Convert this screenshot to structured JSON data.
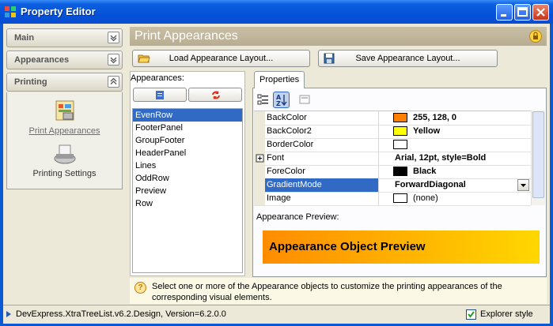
{
  "window": {
    "title": "Property Editor"
  },
  "nav": {
    "groups": [
      {
        "label": "Main",
        "expanded": false
      },
      {
        "label": "Appearances",
        "expanded": false
      },
      {
        "label": "Printing",
        "expanded": true
      }
    ],
    "printing_items": [
      {
        "label": "Print Appearances",
        "selected": true
      },
      {
        "label": "Printing Settings",
        "selected": false
      }
    ]
  },
  "header": {
    "title": "Print Appearances"
  },
  "toolbar": {
    "load_label": "Load Appearance Layout...",
    "save_label": "Save Appearance Layout..."
  },
  "appearances": {
    "label": "Appearances:",
    "items": [
      "EvenRow",
      "FooterPanel",
      "GroupFooter",
      "HeaderPanel",
      "Lines",
      "OddRow",
      "Preview",
      "Row"
    ],
    "selected": "EvenRow"
  },
  "properties": {
    "tab_label": "Properties",
    "rows": [
      {
        "name": "BackColor",
        "value": "255, 128, 0",
        "swatch": "#ff8000"
      },
      {
        "name": "BackColor2",
        "value": "Yellow",
        "swatch": "#ffff00"
      },
      {
        "name": "BorderColor",
        "value": "",
        "swatch": "#ffffff"
      },
      {
        "name": "Font",
        "value": "Arial, 12pt, style=Bold",
        "expandable": true
      },
      {
        "name": "ForeColor",
        "value": "Black",
        "swatch": "#000000"
      },
      {
        "name": "GradientMode",
        "value": "ForwardDiagonal",
        "selected": true
      },
      {
        "name": "Image",
        "value": "(none)",
        "swatch": "#ffffff"
      }
    ]
  },
  "preview": {
    "label": "Appearance Preview:",
    "text": "Appearance Object Preview"
  },
  "hint": {
    "text": "Select one or more of the Appearance objects to customize the printing appearances of the corresponding visual elements."
  },
  "status": {
    "text": "DevExpress.XtraTreeList.v6.2.Design, Version=6.2.0.0",
    "explorer_style_label": "Explorer style",
    "explorer_style_checked": true
  },
  "colors": {
    "title_bar": "#0450d8",
    "selection": "#316ac5",
    "panel": "#ece9d8",
    "header": "#b8ad92"
  }
}
